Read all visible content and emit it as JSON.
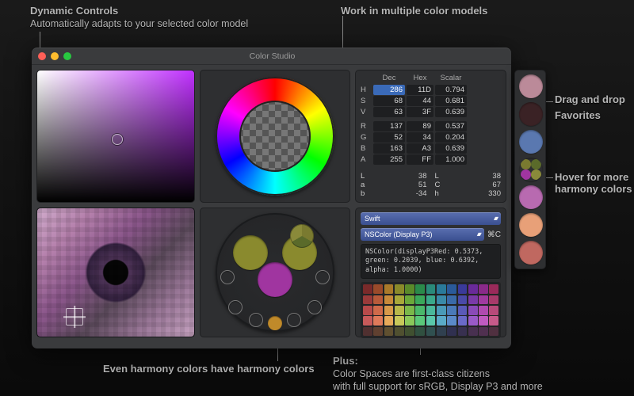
{
  "callouts": {
    "dynamic_controls_title": "Dynamic Controls",
    "dynamic_controls_sub": "Automatically adapts to your selected color model",
    "multi_models": "Work in multiple color models",
    "drag_drop": "Drag and drop",
    "favorites": "Favorites",
    "hover_title": "Hover for more",
    "hover_sub": "harmony colors",
    "harmony_sub": "Even harmony colors have harmony colors",
    "plus_title": "Plus:",
    "plus_line1": "Color Spaces are first-class citizens",
    "plus_line2": "with full support for sRGB, Display P3 and more"
  },
  "window": {
    "title": "Color Studio"
  },
  "values": {
    "headers": [
      "",
      "Dec",
      "Hex",
      "Scalar"
    ],
    "hsv": [
      {
        "label": "H",
        "dec": "286",
        "hex": "11D",
        "scalar": "0.794",
        "selected": true
      },
      {
        "label": "S",
        "dec": "68",
        "hex": "44",
        "scalar": "0.681"
      },
      {
        "label": "V",
        "dec": "63",
        "hex": "3F",
        "scalar": "0.639"
      }
    ],
    "rgba": [
      {
        "label": "R",
        "dec": "137",
        "hex": "89",
        "scalar": "0.537"
      },
      {
        "label": "G",
        "dec": "52",
        "hex": "34",
        "scalar": "0.204"
      },
      {
        "label": "B",
        "dec": "163",
        "hex": "A3",
        "scalar": "0.639"
      },
      {
        "label": "A",
        "dec": "255",
        "hex": "FF",
        "scalar": "1.000"
      }
    ],
    "lab": [
      {
        "label": "L",
        "value": "38"
      },
      {
        "label": "a",
        "value": "51"
      },
      {
        "label": "b",
        "value": "-34"
      }
    ],
    "lch": [
      {
        "label": "L",
        "value": "38"
      },
      {
        "label": "C",
        "value": "67"
      },
      {
        "label": "h",
        "value": "330"
      }
    ]
  },
  "code": {
    "language_select": "Swift",
    "space_select": "NSColor (Display P3)",
    "shortcut": "⌘C",
    "snippet": "NSColor(displayP3Red: 0.5373, green: 0.2039, blue: 0.6392, alpha: 1.0000)"
  },
  "harmony": {
    "big": [
      "#8a8a2e",
      "#8a8a2e",
      "#a035a0"
    ],
    "small_ring": 7,
    "accent_small": "#c08a2a"
  },
  "favorites": [
    "#bb8a99",
    "#3a2225",
    "#5a78b0",
    "multi",
    "#b86ab0",
    "#e8a078",
    "#c06860"
  ],
  "swatch_rows": [
    [
      "#7a2a2a",
      "#9a4a2a",
      "#aa7a2a",
      "#8a8a2a",
      "#5a8a2a",
      "#2a8a4a",
      "#2a8a7a",
      "#2a7a9a",
      "#2a5a9a",
      "#3a3a9a",
      "#6a2a9a",
      "#8a2a8a",
      "#9a2a5a"
    ],
    [
      "#9a3a3a",
      "#b85a3a",
      "#c88a3a",
      "#a8a83a",
      "#6aa83a",
      "#3aa85a",
      "#3aa88a",
      "#3a8aa8",
      "#3a6aa8",
      "#4a4aa8",
      "#7a3aa8",
      "#a03aa0",
      "#a83a6a"
    ],
    [
      "#b84a4a",
      "#d06a4a",
      "#d89a4a",
      "#b8b84a",
      "#7ab84a",
      "#4ab86a",
      "#4ab89a",
      "#4a9ab8",
      "#4a7ab8",
      "#5a5ab8",
      "#8a4ab8",
      "#b04ab0",
      "#b84a7a"
    ],
    [
      "#c85a5a",
      "#e07a5a",
      "#e8aa5a",
      "#c8c85a",
      "#8ac85a",
      "#5ac87a",
      "#5ac8aa",
      "#5aaac8",
      "#5a8ac8",
      "#6a6ac8",
      "#9a5ac8",
      "#c05ac0",
      "#c85a8a"
    ],
    [
      "#503030",
      "#604030",
      "#605030",
      "#505030",
      "#405030",
      "#305040",
      "#305050",
      "#304050",
      "#303050",
      "#383050",
      "#483050",
      "#503050",
      "#503040"
    ]
  ]
}
